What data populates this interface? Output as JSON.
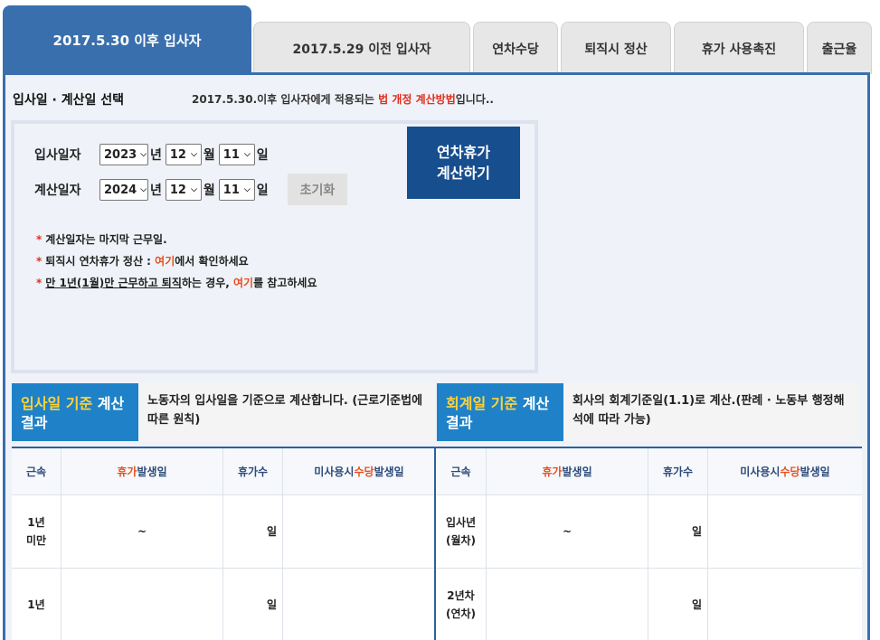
{
  "tabs": [
    {
      "label": "2017.5.30 이후 입사자",
      "active": true
    },
    {
      "label": "2017.5.29 이전 입사자",
      "active": false
    },
    {
      "label": "연차수당",
      "active": false
    },
    {
      "label": "퇴직시 정산",
      "active": false
    },
    {
      "label": "휴가 사용촉진",
      "active": false
    },
    {
      "label": "출근율",
      "active": false
    }
  ],
  "section": {
    "title": "입사일 · 계산일 선택",
    "desc_pre": "2017.5.30.이후 입사자에게 적용되는 ",
    "desc_highlight": "법 개정 계산방법",
    "desc_post": "입니다.."
  },
  "form": {
    "hire_label": "입사일자",
    "calc_label": "계산일자",
    "hire_year": "2023",
    "hire_month": "12",
    "hire_day": "11",
    "calc_year": "2024",
    "calc_month": "12",
    "calc_day": "11",
    "unit_year": "년",
    "unit_month": "월",
    "unit_day": "일",
    "reset_label": "초기화",
    "calc_button_line1": "연차휴가",
    "calc_button_line2": "계산하기"
  },
  "notes": {
    "n1": "계산일자는 마지막 근무일.",
    "n2_pre": "퇴직시 연차휴가 정산 : ",
    "n2_link": "여기",
    "n2_post": "에서 확인하세요",
    "n3_underlined": "만 1년(1월)만 근무하고 퇴직",
    "n3_mid": "하는 경우, ",
    "n3_link": "여기",
    "n3_post": "를 참고하세요"
  },
  "result_left": {
    "title_a": "입사일 기준",
    "title_b": " 계산 결과",
    "desc": "노동자의 입사일을 기준으로 계산합니다. (근로기준법에 따른 원칙)"
  },
  "result_right": {
    "title_a": "회계일 기준",
    "title_b": " 계산 결과",
    "desc": "회사의 회계기준일(1.1)로 계산.(판례 · 노동부 행정해석에 따라 가능)"
  },
  "table_headers": {
    "tenure": "근속",
    "leave_date_a": "휴가",
    "leave_date_b": " 발생일",
    "leave_count": "휴가수",
    "pay_date_a": "미사용시 ",
    "pay_date_b": "수당",
    "pay_date_c": " 발생일"
  },
  "left_rows": [
    {
      "tenure": "1년\n미만",
      "date": "~",
      "count": "일"
    },
    {
      "tenure": "1년",
      "date": "",
      "count": "일"
    }
  ],
  "right_rows": [
    {
      "tenure": "입사년\n(월차)",
      "date": "~",
      "count": "일"
    },
    {
      "tenure": "2년차\n(연차)",
      "date": "",
      "count": "일"
    }
  ],
  "asterisk": "*"
}
